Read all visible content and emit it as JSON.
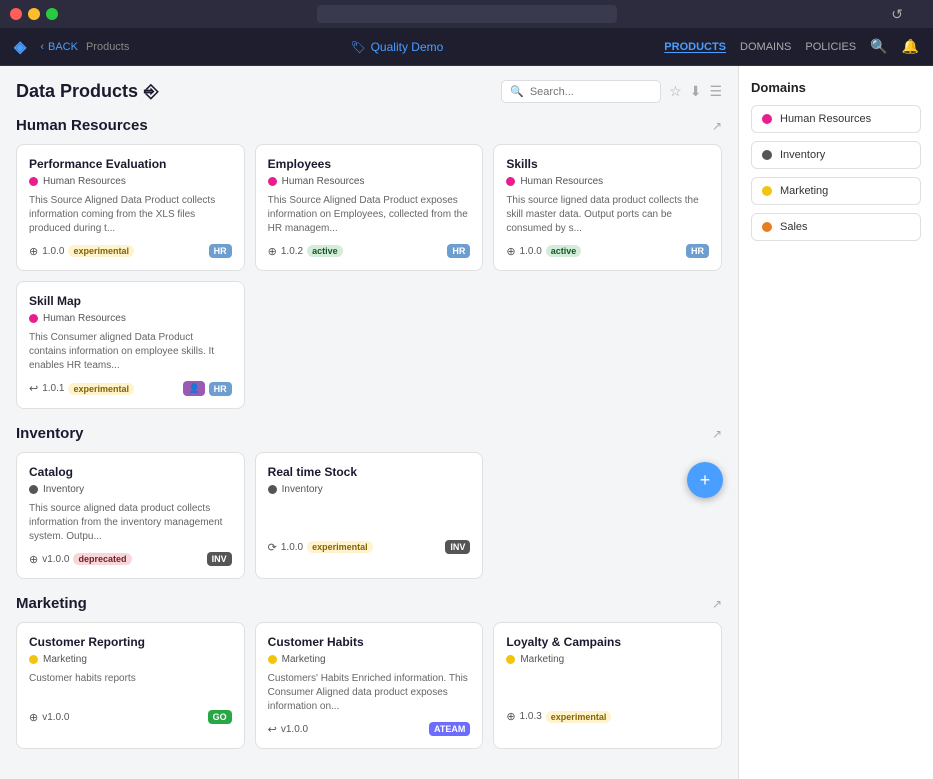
{
  "titlebar": {
    "url": ""
  },
  "navbar": {
    "logo": "◈",
    "back_label": "BACK",
    "breadcrumb": "Products",
    "app_name": "Quality Demo",
    "app_icon": "🏷",
    "links": {
      "products": "PRODUCTS",
      "domains": "DOMAINS",
      "policies": "POLICIES"
    }
  },
  "header": {
    "title": "Data Products",
    "title_icon": "⎆",
    "search_placeholder": "Search..."
  },
  "sections": [
    {
      "id": "human-resources",
      "title": "Human Resources",
      "cards": [
        {
          "id": "performance-evaluation",
          "title": "Performance Evaluation",
          "domain": "Human Resources",
          "domain_color": "#e91e8c",
          "description": "This Source Aligned Data Product collects information coming from the XLS files produced during t...",
          "version": "1.0.0",
          "version_icon": "⊕",
          "status": "experimental",
          "badge": "HR",
          "badge_color": "#6c9ecf"
        },
        {
          "id": "employees",
          "title": "Employees",
          "domain": "Human Resources",
          "domain_color": "#e91e8c",
          "description": "This Source Aligned Data Product exposes information on Employees, collected from the HR managem...",
          "version": "1.0.2",
          "version_icon": "⊕",
          "status": "active",
          "badge": "HR",
          "badge_color": "#6c9ecf"
        },
        {
          "id": "skills",
          "title": "Skills",
          "domain": "Human Resources",
          "domain_color": "#e91e8c",
          "description": "This source ligned data product collects the skill master data. Output ports can be consumed by s...",
          "version": "1.0.0",
          "version_icon": "⊕",
          "status": "active",
          "badge": "HR",
          "badge_color": "#6c9ecf"
        },
        {
          "id": "skill-map",
          "title": "Skill Map",
          "domain": "Human Resources",
          "domain_color": "#e91e8c",
          "description": "This Consumer aligned Data Product contains information on employee skills. It enables HR teams...",
          "version": "1.0.1",
          "version_icon": "↩",
          "status": "experimental",
          "badge": "HR",
          "badge_color": "#6c9ecf",
          "extra_badge": "👤",
          "extra_badge_color": "#9b59b6"
        }
      ]
    },
    {
      "id": "inventory",
      "title": "Inventory",
      "cards": [
        {
          "id": "catalog",
          "title": "Catalog",
          "domain": "Inventory",
          "domain_color": "#555",
          "description": "This source aligned data product collects information from the inventory management system. Outpu...",
          "version": "v1.0.0",
          "version_icon": "⊕",
          "status": "deprecated",
          "badge": "INV",
          "badge_color": "#555"
        },
        {
          "id": "real-time-stock",
          "title": "Real time Stock",
          "domain": "Inventory",
          "domain_color": "#555",
          "description": "",
          "version": "1.0.0",
          "version_icon": "⟳",
          "status": "experimental",
          "badge": "INV",
          "badge_color": "#555"
        }
      ]
    },
    {
      "id": "marketing",
      "title": "Marketing",
      "cards": [
        {
          "id": "customer-reporting",
          "title": "Customer Reporting",
          "domain": "Marketing",
          "domain_color": "#f1c40f",
          "description": "Customer habits reports",
          "version": "v1.0.0",
          "version_icon": "⊕",
          "status": "",
          "badge": "GO",
          "badge_color": "#28a745"
        },
        {
          "id": "customer-habits",
          "title": "Customer Habits",
          "domain": "Marketing",
          "domain_color": "#f1c40f",
          "description": "Customers' Habits Enriched information. This Consumer Aligned data product exposes information on...",
          "version": "v1.0.0",
          "version_icon": "↩",
          "status": "",
          "badge": "ATEAM",
          "badge_color": "#6c6cff"
        },
        {
          "id": "loyalty-campains",
          "title": "Loyalty & Campains",
          "domain": "Marketing",
          "domain_color": "#f1c40f",
          "description": "",
          "version": "1.0.3",
          "version_icon": "⊕",
          "status": "experimental",
          "badge": "",
          "badge_color": ""
        }
      ]
    }
  ],
  "sidebar": {
    "title": "Domains",
    "items": [
      {
        "label": "Human Resources",
        "color": "#e91e8c"
      },
      {
        "label": "Inventory",
        "color": "#555"
      },
      {
        "label": "Marketing",
        "color": "#f1c40f"
      },
      {
        "label": "Sales",
        "color": "#e67e22"
      }
    ]
  }
}
